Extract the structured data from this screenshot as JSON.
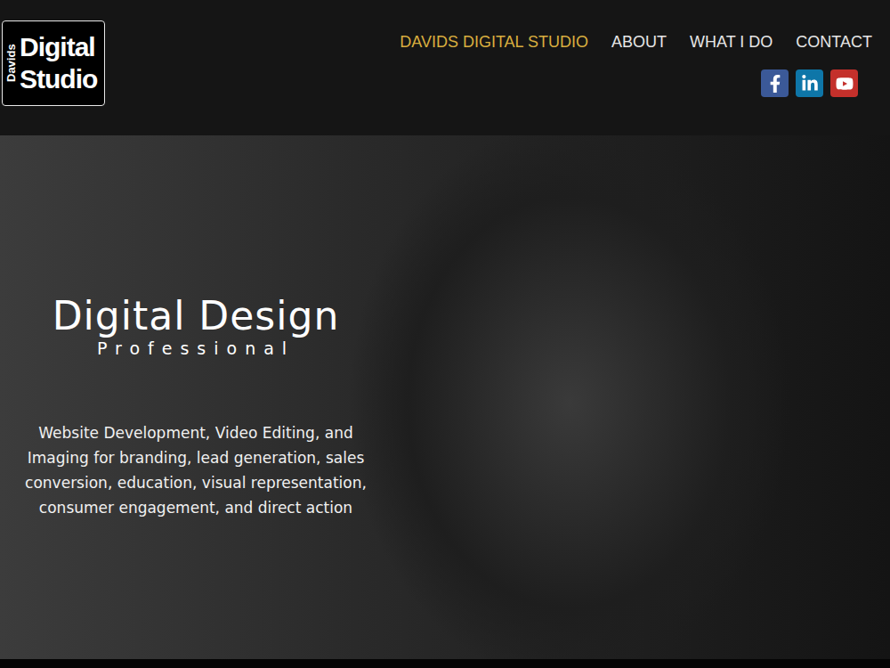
{
  "logo": {
    "side": "Davids",
    "lines": [
      "Digital",
      "Studio"
    ]
  },
  "nav": [
    {
      "label": "DAVIDS DIGITAL STUDIO",
      "selected": true
    },
    {
      "label": "ABOUT",
      "selected": false
    },
    {
      "label": "WHAT I DO",
      "selected": false
    },
    {
      "label": "CONTACT",
      "selected": false
    }
  ],
  "hero": {
    "title": "Digital Design",
    "subtitle": "Professional",
    "description": [
      "Website Development, Video Editing, and",
      "Imaging for branding, lead generation, sales",
      "conversion, education, visual representation,",
      "consumer engagement, and direct action"
    ]
  }
}
